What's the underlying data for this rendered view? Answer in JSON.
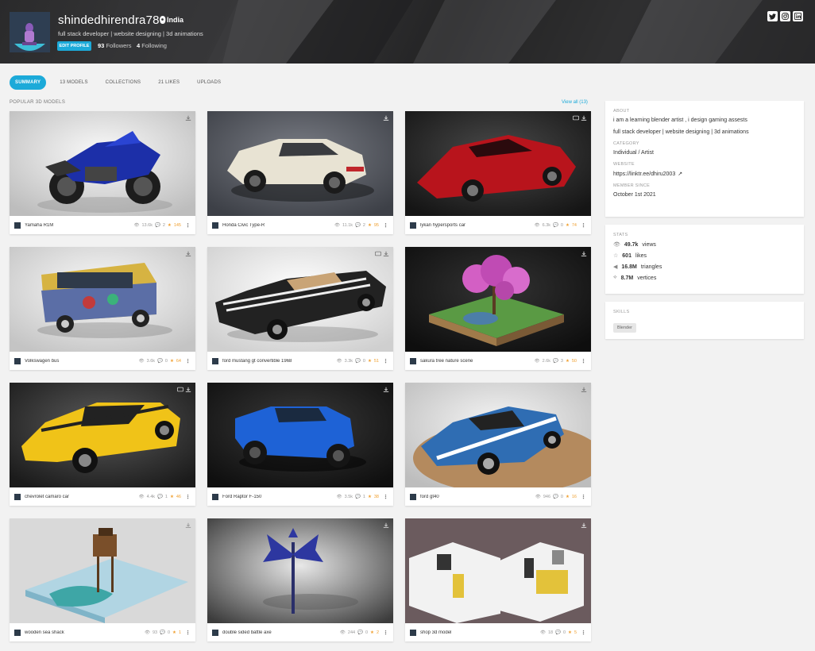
{
  "profile": {
    "name": "shindedhirendra780",
    "location": "India",
    "tagline": "full stack developer | website designing | 3d animations",
    "edit_label": "EDIT PROFILE",
    "followers_count": "93",
    "followers_label": "Followers",
    "following_count": "4",
    "following_label": "Following"
  },
  "social": [
    {
      "icon": "twitter-icon"
    },
    {
      "icon": "instagram-icon"
    },
    {
      "icon": "linkedin-icon"
    }
  ],
  "tabs": [
    "SUMMARY",
    "13 MODELS",
    "COLLECTIONS",
    "21 LIKES",
    "UPLOADS"
  ],
  "section": {
    "title": "POPULAR 3D MODELS",
    "view_all": "View all (13)"
  },
  "models": [
    {
      "title": "Yamaha R1M",
      "views": "13.6k",
      "comments": "2",
      "likes": "145"
    },
    {
      "title": "Honda Civic Type-R",
      "views": "11.1k",
      "comments": "2",
      "likes": "95"
    },
    {
      "title": "lykan hypersports car",
      "views": "6.3k",
      "comments": "0",
      "likes": "74"
    },
    {
      "title": "Volkswagen bus",
      "views": "3.6k",
      "comments": "0",
      "likes": "64"
    },
    {
      "title": "ford mustang gt convertible 1968",
      "views": "3.3k",
      "comments": "0",
      "likes": "51"
    },
    {
      "title": "sakura tree nature scene",
      "views": "2.6k",
      "comments": "3",
      "likes": "50"
    },
    {
      "title": "chevrolet camaro car",
      "views": "4.4k",
      "comments": "1",
      "likes": "46"
    },
    {
      "title": "Ford Raptor F-150",
      "views": "3.5k",
      "comments": "1",
      "likes": "38"
    },
    {
      "title": "ford gt40",
      "views": "946",
      "comments": "0",
      "likes": "16"
    },
    {
      "title": "wooden sea shack",
      "views": "93",
      "comments": "0",
      "likes": "1"
    },
    {
      "title": "double sided battle axe",
      "views": "244",
      "comments": "0",
      "likes": "2"
    },
    {
      "title": "shop 3d model",
      "views": "18",
      "comments": "0",
      "likes": "5"
    }
  ],
  "about": {
    "label": "ABOUT",
    "line1": "i am a learning blender artist , i design gaming assests",
    "line2": "full stack developer | website designing | 3d animations",
    "category_label": "CATEGORY",
    "category": "Individual / Artist",
    "website_label": "WEBSITE",
    "website": "https://linktr.ee/dhiru2003",
    "member_label": "MEMBER SINCE",
    "member_since": "October 1st 2021"
  },
  "stats": {
    "label": "STATS",
    "views_value": "49.7k",
    "views_label": "views",
    "likes_value": "601",
    "likes_label": "likes",
    "triangles_value": "16.8M",
    "triangles_label": "triangles",
    "vertices_value": "8.7M",
    "vertices_label": "vertices"
  },
  "skills": {
    "label": "SKILLS",
    "items": [
      "Blender"
    ]
  },
  "colors": {
    "accent": "#1caad9",
    "star": "#f0a030"
  }
}
